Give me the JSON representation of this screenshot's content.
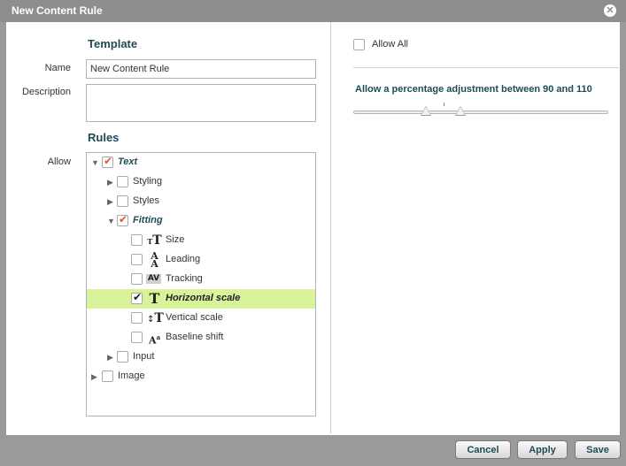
{
  "window": {
    "title": "New Content Rule"
  },
  "template": {
    "heading": "Template",
    "name_label": "Name",
    "name_value": "New Content Rule",
    "description_label": "Description",
    "description_value": ""
  },
  "rules": {
    "heading": "Rules",
    "allow_label": "Allow",
    "tree": [
      {
        "label": "Text",
        "checked": true
      },
      {
        "label": "Styling",
        "checked": false
      },
      {
        "label": "Styles",
        "checked": false
      },
      {
        "label": "Fitting",
        "checked": true
      },
      {
        "label": "Size",
        "checked": false
      },
      {
        "label": "Leading",
        "checked": false
      },
      {
        "label": "Tracking",
        "checked": false
      },
      {
        "label": "Horizontal scale",
        "checked": true
      },
      {
        "label": "Vertical scale",
        "checked": false
      },
      {
        "label": "Baseline shift",
        "checked": false
      },
      {
        "label": "Input",
        "checked": false
      },
      {
        "label": "Image",
        "checked": false
      }
    ]
  },
  "right": {
    "allow_all_label": "Allow All",
    "slider_label": "Allow a percentage adjustment between 90 and 110",
    "slider_range": [
      90,
      110
    ]
  },
  "footer": {
    "cancel": "Cancel",
    "apply": "Apply",
    "save": "Save"
  },
  "colors": {
    "accent": "#1e4b57",
    "selected_row": "#d9f39a",
    "check": "#e8542a"
  }
}
